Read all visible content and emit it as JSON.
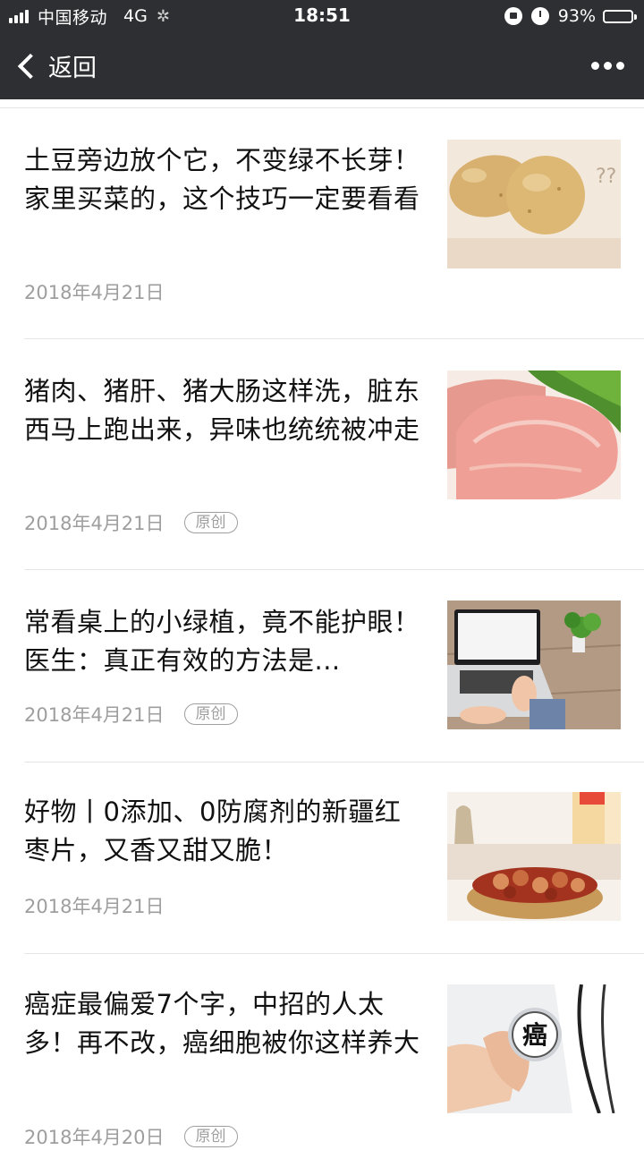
{
  "status_bar": {
    "carrier": "中国移动",
    "network": "4G",
    "time": "18:51",
    "battery": "93%",
    "battery_level": 0.93
  },
  "nav": {
    "back_label": "返回"
  },
  "articles": [
    {
      "title": "土豆旁边放个它，不变绿不长芽！家里买菜的，这个技巧一定要看看",
      "date": "2018年4月21日",
      "badge": "",
      "thumb_caption": "??"
    },
    {
      "title": "猪肉、猪肝、猪大肠这样洗，脏东西马上跑出来，异味也统统被冲走",
      "date": "2018年4月21日",
      "badge": "原创"
    },
    {
      "title": "常看桌上的小绿植，竟不能护眼！医生：真正有效的方法是...",
      "date": "2018年4月21日",
      "badge": "原创"
    },
    {
      "title": "好物丨0添加、0防腐剂的新疆红枣片，又香又甜又脆！",
      "date": "2018年4月21日",
      "badge": ""
    },
    {
      "title": "癌症最偏爱7个字，中招的人太多！再不改，癌细胞被你这样养大",
      "date": "2018年4月20日",
      "badge": "原创",
      "thumb_caption": "癌"
    }
  ]
}
